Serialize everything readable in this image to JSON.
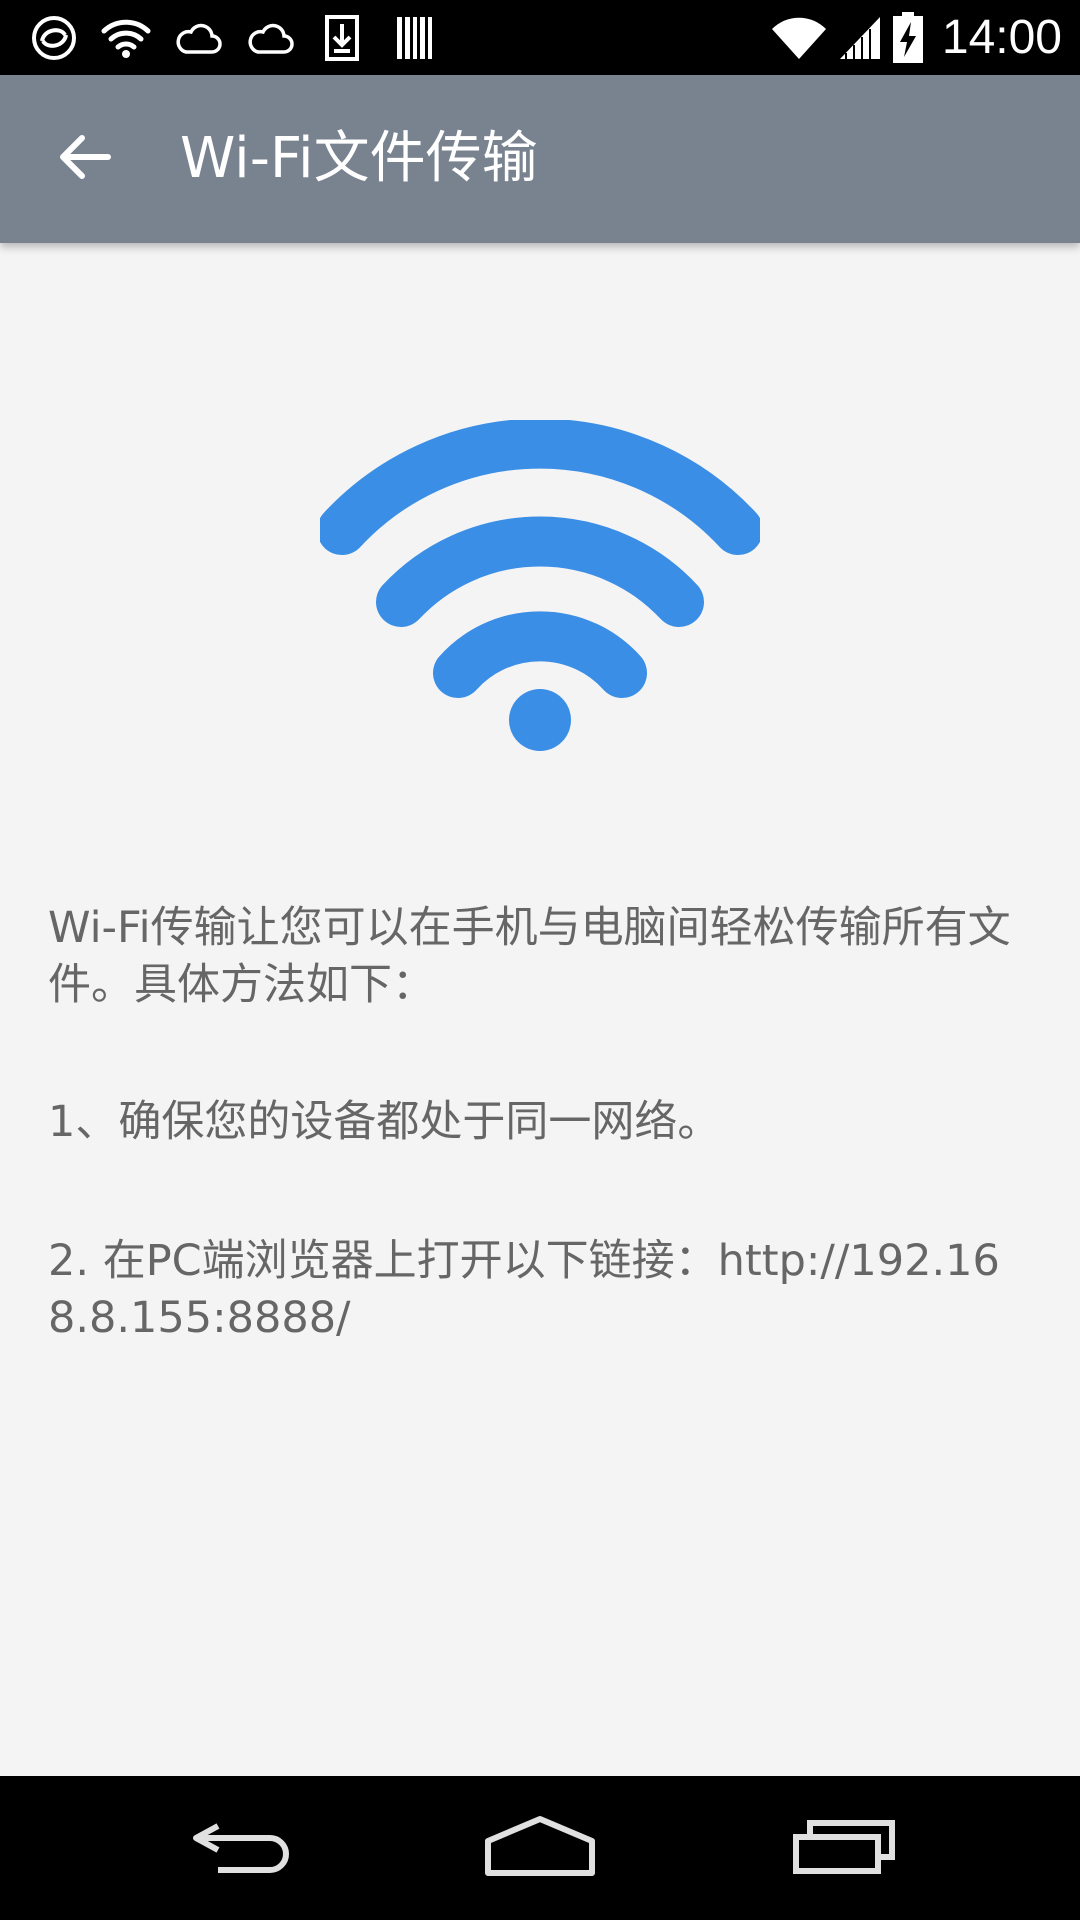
{
  "status_bar": {
    "time": "14:00",
    "left_icons": [
      "sync-icon",
      "wifi-notification-icon",
      "cloud-icon",
      "cloud-icon",
      "download-icon",
      "barcode-icon"
    ],
    "right_icons": [
      "wifi-signal-icon",
      "cell-signal-icon",
      "battery-charging-icon"
    ]
  },
  "app_bar": {
    "title": "Wi-Fi文件传输",
    "back_icon": "arrow-back-icon",
    "background_color": "#78838f"
  },
  "illustration": {
    "icon": "wifi-icon",
    "color": "#3a8ee6"
  },
  "content": {
    "intro": "Wi-Fi传输让您可以在手机与电脑间轻松传输所有文件。具体方法如下：",
    "step1": "1、确保您的设备都处于同一网络。",
    "step2": "2. 在PC端浏览器上打开以下链接：http://192.168.8.155:8888/"
  },
  "nav_bar": {
    "buttons": [
      "back-icon",
      "home-icon",
      "recents-icon"
    ]
  }
}
